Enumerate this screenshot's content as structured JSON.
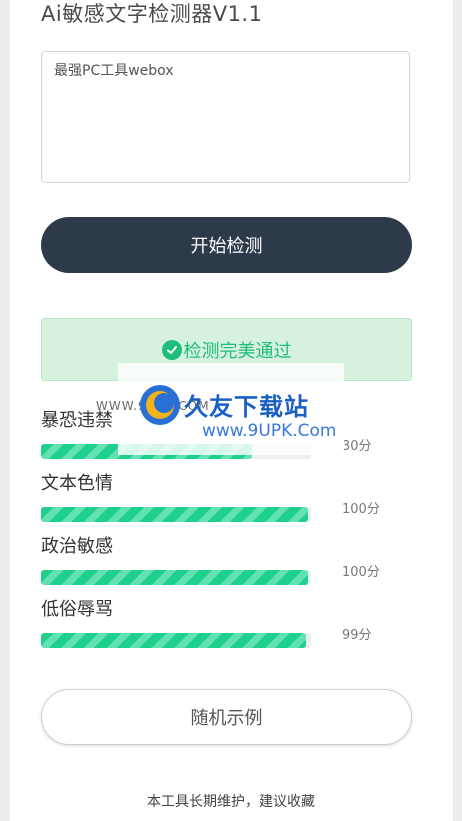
{
  "app": {
    "title": "Ai敏感文字检测器V1.1"
  },
  "input": {
    "value": "最强PC工具webox"
  },
  "actions": {
    "detect_label": "开始检测",
    "random_label": "随机示例"
  },
  "result": {
    "message": "检测完美通过",
    "icon": "check-circle-icon",
    "color": "#1ebd7a"
  },
  "metrics": [
    {
      "label": "暴恐违禁",
      "score": "30分",
      "level": 0.78
    },
    {
      "label": "文本色情",
      "score": "100分",
      "level": 0.99
    },
    {
      "label": "政治敏感",
      "score": "100分",
      "level": 0.99
    },
    {
      "label": "低俗辱骂",
      "score": "99分",
      "level": 0.98
    }
  ],
  "footer": {
    "text": "本工具长期维护，建议收藏"
  },
  "watermark": {
    "brand": "久友下载站",
    "url": "www.9UPK.Com",
    "small": "WWW.9UPK.COM"
  },
  "colors": {
    "primary_button": "#2d3a4a",
    "bar": "#1fcf8c",
    "result_bg": "#d7f1df"
  }
}
